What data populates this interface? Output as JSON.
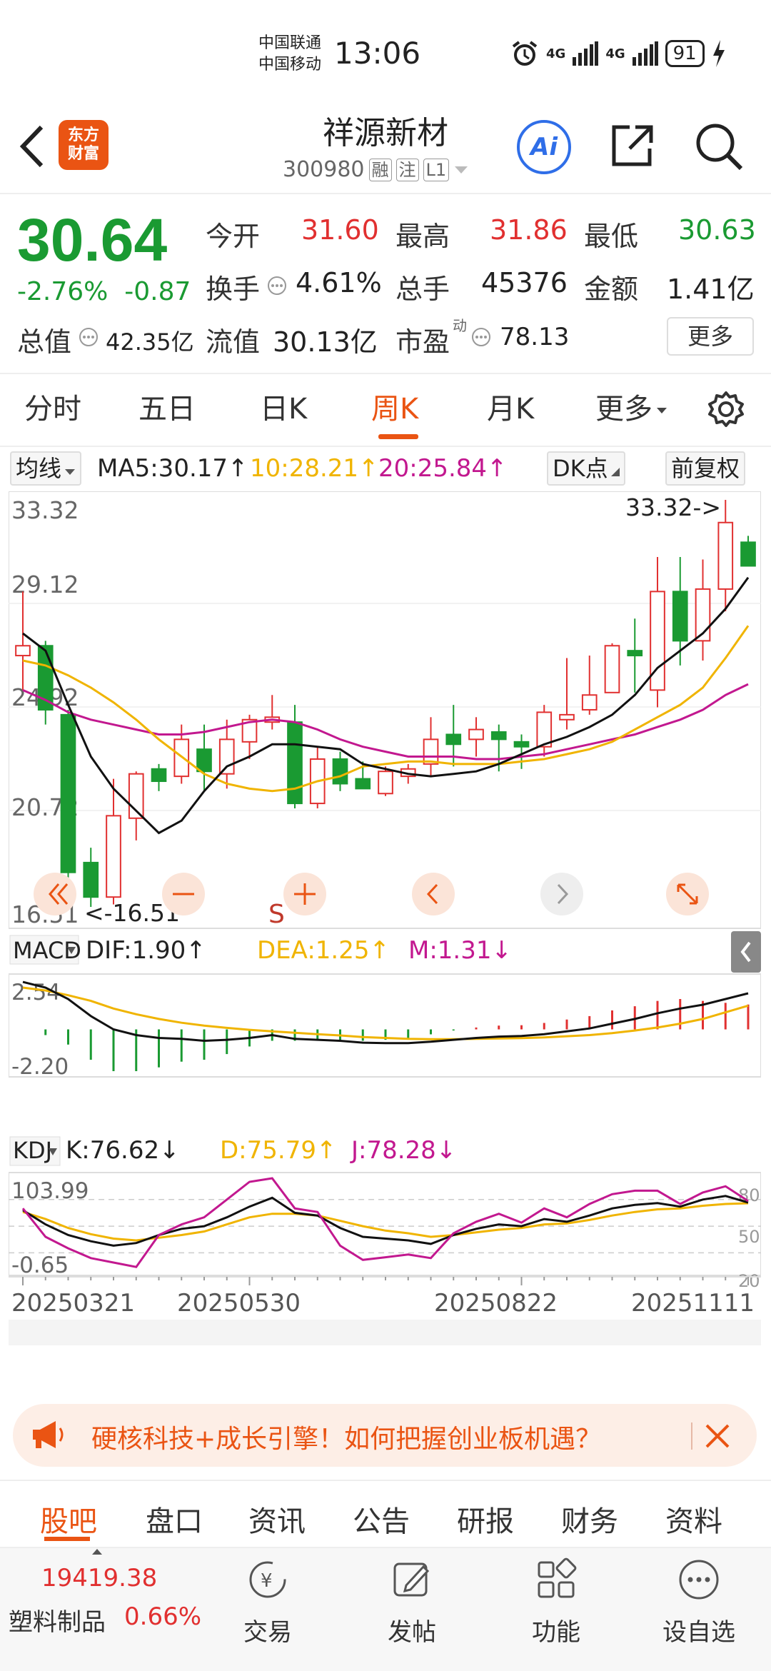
{
  "status_bar": {
    "carrier_1": "中国联通",
    "carrier_2": "中国移动",
    "time": "13:06",
    "net_1": "4G",
    "net_2": "4G",
    "battery": "91"
  },
  "header": {
    "logo_line1": "东方",
    "logo_line2": "财富",
    "stock_name": "祥源新材",
    "stock_code": "300980",
    "tags": [
      "融",
      "注",
      "L1"
    ],
    "ai_label": "Ai"
  },
  "quote": {
    "price": "30.64",
    "change_pct": "-2.76%",
    "change_abs": "-0.87",
    "open_label": "今开",
    "open": "31.60",
    "high_label": "最高",
    "high": "31.86",
    "low_label": "最低",
    "low": "30.63",
    "turnover_label": "换手",
    "turnover": "4.61%",
    "volume_label": "总手",
    "volume": "45376",
    "amount_label": "金额",
    "amount": "1.41亿",
    "total_cap_label": "总值",
    "total_cap": "42.35亿",
    "float_cap_label": "流值",
    "float_cap": "30.13亿",
    "pe_label": "市盈",
    "pe_sup": "动",
    "pe": "78.13",
    "more_label": "更多"
  },
  "period_tabs": [
    "分时",
    "五日",
    "日K",
    "周K",
    "月K",
    "更多"
  ],
  "active_period": "周K",
  "ma_row": {
    "selector": "均线",
    "ma5": "MA5:30.17↑",
    "ma10": "10:28.21↑",
    "ma20": "20:25.84↑",
    "dk_btn": "DK点",
    "adjust_btn": "前复权"
  },
  "price_axis": [
    "33.32",
    "29.12",
    "24.92",
    "20.72",
    "16.51"
  ],
  "price_markers": {
    "high": "33.32->",
    "low": "<-16.51",
    "signal": "S"
  },
  "macd_row": {
    "selector": "MACD",
    "dif": "DIF:1.90↑",
    "dea": "DEA:1.25↑",
    "m": "M:1.31↓"
  },
  "macd_axis": [
    "2.54",
    "-2.20"
  ],
  "kdj_row": {
    "selector": "KDJ",
    "k": "K:76.62↓",
    "d": "D:75.79↑",
    "j": "J:78.28↓"
  },
  "kdj_axis": [
    "103.99",
    "-0.65"
  ],
  "kdj_right_axis": [
    "80",
    "50",
    "20"
  ],
  "date_axis": [
    "20250321",
    "20250530",
    "20250822",
    "20251111"
  ],
  "chart_data": {
    "type": "candlestick",
    "period": "weekly",
    "ylim": [
      16.51,
      33.32
    ],
    "candles": [
      {
        "o": 27.0,
        "h": 29.6,
        "l": 25.6,
        "c": 27.4
      },
      {
        "o": 27.4,
        "h": 27.6,
        "l": 24.2,
        "c": 24.8
      },
      {
        "o": 24.6,
        "h": 24.8,
        "l": 16.9,
        "c": 18.2
      },
      {
        "o": 18.6,
        "h": 19.2,
        "l": 16.8,
        "c": 17.2
      },
      {
        "o": 17.2,
        "h": 22.0,
        "l": 16.9,
        "c": 20.5
      },
      {
        "o": 20.4,
        "h": 22.3,
        "l": 19.5,
        "c": 22.2
      },
      {
        "o": 22.4,
        "h": 22.6,
        "l": 21.5,
        "c": 21.9
      },
      {
        "o": 22.1,
        "h": 24.2,
        "l": 21.8,
        "c": 23.6
      },
      {
        "o": 23.2,
        "h": 24.2,
        "l": 21.5,
        "c": 22.3
      },
      {
        "o": 22.2,
        "h": 24.4,
        "l": 21.6,
        "c": 23.6
      },
      {
        "o": 23.5,
        "h": 24.6,
        "l": 22.8,
        "c": 24.4
      },
      {
        "o": 24.3,
        "h": 25.4,
        "l": 24.0,
        "c": 24.5
      },
      {
        "o": 24.3,
        "h": 25.0,
        "l": 20.8,
        "c": 21.0
      },
      {
        "o": 21.0,
        "h": 23.3,
        "l": 20.8,
        "c": 22.8
      },
      {
        "o": 22.8,
        "h": 23.1,
        "l": 21.5,
        "c": 21.8
      },
      {
        "o": 22.0,
        "h": 22.7,
        "l": 21.6,
        "c": 21.6
      },
      {
        "o": 21.4,
        "h": 22.5,
        "l": 21.3,
        "c": 22.3
      },
      {
        "o": 22.1,
        "h": 22.6,
        "l": 21.8,
        "c": 22.4
      },
      {
        "o": 22.6,
        "h": 24.5,
        "l": 22.1,
        "c": 23.6
      },
      {
        "o": 23.8,
        "h": 25.0,
        "l": 22.5,
        "c": 23.4
      },
      {
        "o": 23.6,
        "h": 24.5,
        "l": 22.9,
        "c": 24.0
      },
      {
        "o": 23.9,
        "h": 24.2,
        "l": 22.3,
        "c": 23.6
      },
      {
        "o": 23.5,
        "h": 23.8,
        "l": 22.4,
        "c": 23.3
      },
      {
        "o": 23.3,
        "h": 25.0,
        "l": 22.9,
        "c": 24.7
      },
      {
        "o": 24.4,
        "h": 26.9,
        "l": 24.0,
        "c": 24.6
      },
      {
        "o": 24.8,
        "h": 27.0,
        "l": 24.6,
        "c": 25.4
      },
      {
        "o": 25.5,
        "h": 27.5,
        "l": 25.5,
        "c": 27.4
      },
      {
        "o": 27.2,
        "h": 28.5,
        "l": 25.5,
        "c": 27.0
      },
      {
        "o": 25.6,
        "h": 31.0,
        "l": 24.9,
        "c": 29.6
      },
      {
        "o": 29.6,
        "h": 31.0,
        "l": 26.6,
        "c": 27.6
      },
      {
        "o": 27.6,
        "h": 30.9,
        "l": 26.8,
        "c": 29.7
      },
      {
        "o": 29.7,
        "h": 33.32,
        "l": 28.8,
        "c": 32.4
      },
      {
        "o": 31.6,
        "h": 31.86,
        "l": 30.63,
        "c": 30.64
      }
    ],
    "ma5": [
      27.9,
      27.2,
      25.0,
      22.9,
      21.6,
      20.7,
      19.8,
      20.3,
      21.5,
      22.5,
      22.9,
      23.4,
      23.4,
      23.3,
      23.2,
      22.6,
      22.4,
      22.2,
      22.1,
      22.2,
      22.3,
      22.6,
      23.0,
      23.4,
      23.7,
      24.1,
      24.6,
      25.4,
      26.5,
      27.2,
      27.9,
      28.9,
      30.17
    ],
    "ma10": [
      26.8,
      26.6,
      26.2,
      25.7,
      25.1,
      24.4,
      23.6,
      22.9,
      22.2,
      21.8,
      21.6,
      21.5,
      21.6,
      21.9,
      22.1,
      22.5,
      22.6,
      22.7,
      22.7,
      22.6,
      22.6,
      22.6,
      22.7,
      22.8,
      23.0,
      23.2,
      23.5,
      24.0,
      24.5,
      25.0,
      25.7,
      26.9,
      28.21
    ],
    "ma20": [
      25.6,
      25.2,
      24.7,
      24.4,
      24.2,
      24.0,
      23.8,
      23.8,
      23.9,
      24.1,
      24.3,
      24.4,
      24.3,
      24.0,
      23.6,
      23.3,
      23.1,
      22.9,
      22.9,
      22.9,
      22.8,
      22.8,
      22.9,
      23.0,
      23.2,
      23.4,
      23.6,
      23.8,
      24.1,
      24.4,
      24.8,
      25.4,
      25.84
    ],
    "macd": {
      "ylim": [
        -2.2,
        2.54
      ],
      "dif": [
        2.5,
        2.2,
        1.6,
        0.7,
        0.0,
        -0.3,
        -0.45,
        -0.5,
        -0.6,
        -0.55,
        -0.45,
        -0.3,
        -0.5,
        -0.55,
        -0.6,
        -0.7,
        -0.72,
        -0.72,
        -0.65,
        -0.55,
        -0.45,
        -0.38,
        -0.35,
        -0.25,
        -0.1,
        0.05,
        0.3,
        0.55,
        0.85,
        1.1,
        1.3,
        1.6,
        1.9
      ],
      "dea": [
        2.2,
        2.05,
        1.8,
        1.5,
        1.1,
        0.8,
        0.55,
        0.35,
        0.2,
        0.08,
        -0.02,
        -0.1,
        -0.18,
        -0.25,
        -0.32,
        -0.4,
        -0.45,
        -0.5,
        -0.52,
        -0.52,
        -0.5,
        -0.48,
        -0.46,
        -0.42,
        -0.36,
        -0.3,
        -0.2,
        -0.06,
        0.1,
        0.3,
        0.55,
        0.9,
        1.25
      ],
      "m": [
        0.0,
        -0.3,
        -0.8,
        -1.6,
        -2.2,
        -2.2,
        -2.0,
        -1.7,
        -1.6,
        -1.3,
        -0.9,
        -0.6,
        -0.6,
        -0.6,
        -0.55,
        -0.6,
        -0.55,
        -0.45,
        -0.26,
        -0.06,
        0.1,
        0.2,
        0.22,
        0.34,
        0.52,
        0.7,
        1.0,
        1.22,
        1.5,
        1.6,
        1.5,
        1.4,
        1.31
      ]
    },
    "kdj": {
      "ylim": [
        -0.65,
        103.99
      ],
      "k": [
        68,
        52,
        40,
        33,
        28,
        31,
        40,
        47,
        50,
        60,
        72,
        82,
        65,
        62,
        48,
        38,
        36,
        34,
        30,
        40,
        47,
        52,
        50,
        58,
        55,
        62,
        70,
        74,
        76,
        72,
        80,
        84,
        76.62
      ],
      "d": [
        66,
        58,
        48,
        41,
        36,
        34,
        37,
        40,
        44,
        52,
        60,
        64,
        64,
        62,
        56,
        50,
        45,
        42,
        38,
        40,
        43,
        46,
        48,
        52,
        53,
        57,
        62,
        66,
        69,
        70,
        73,
        75,
        75.79
      ],
      "j": [
        70,
        38,
        25,
        14,
        9,
        4,
        40,
        52,
        60,
        80,
        100,
        104,
        70,
        66,
        28,
        12,
        15,
        18,
        14,
        42,
        55,
        64,
        54,
        70,
        60,
        75,
        86,
        90,
        90,
        75,
        88,
        95,
        78.28
      ]
    },
    "right_labels": [
      "80",
      "50",
      "20"
    ]
  },
  "banner": {
    "text": "硬核科技+成长引擎！如何把握创业板机遇？"
  },
  "content_tabs": [
    "股吧",
    "盘口",
    "资讯",
    "公告",
    "研报",
    "财务",
    "资料"
  ],
  "active_content_tab": "股吧",
  "bottom_bar": {
    "index_value": "19419.38",
    "index_name": "塑料制品",
    "index_pct": "0.66%",
    "items": [
      "交易",
      "发帖",
      "功能",
      "设自选"
    ]
  },
  "colors": {
    "up": "#e13030",
    "down": "#1a9a32",
    "accent": "#ea5413",
    "ma5": "#111111",
    "ma10": "#f0b400",
    "ma20": "#c2188f"
  }
}
